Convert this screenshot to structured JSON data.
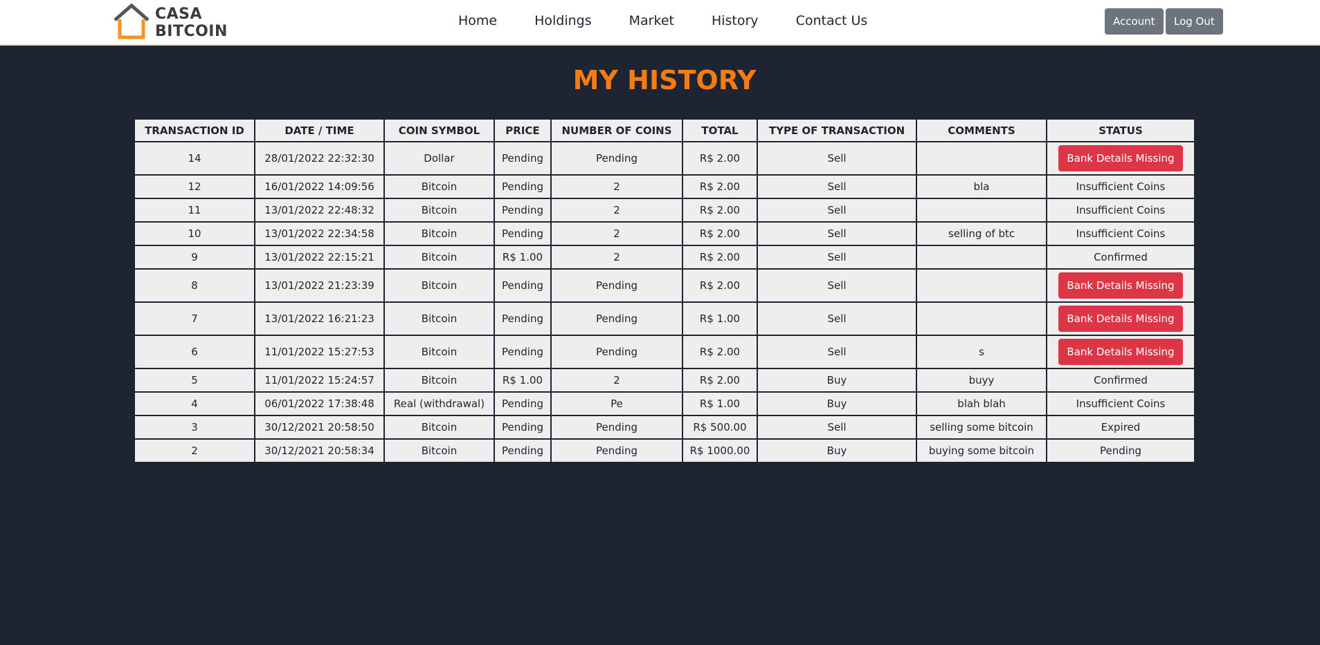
{
  "brand": {
    "line1": "CASA",
    "line2": "BITCOIN",
    "color": "#f7941d"
  },
  "nav": {
    "links": [
      "Home",
      "Holdings",
      "Market",
      "History",
      "Contact Us"
    ],
    "account_label": "Account",
    "logout_label": "Log Out"
  },
  "page": {
    "title": "MY HISTORY"
  },
  "table": {
    "headers": [
      "TRANSACTION ID",
      "DATE / TIME",
      "COIN SYMBOL",
      "PRICE",
      "NUMBER OF COINS",
      "TOTAL",
      "TYPE OF TRANSACTION",
      "COMMENTS",
      "STATUS"
    ],
    "rows": [
      [
        "14",
        "28/01/2022 22:32:30",
        "Dollar",
        "Pending",
        "Pending",
        "R$ 2.00",
        "Sell",
        "",
        "Bank Details Missing"
      ],
      [
        "12",
        "16/01/2022 14:09:56",
        "Bitcoin",
        "Pending",
        "2",
        "R$ 2.00",
        "Sell",
        "bla",
        "Insufficient Coins"
      ],
      [
        "11",
        "13/01/2022 22:48:32",
        "Bitcoin",
        "Pending",
        "2",
        "R$ 2.00",
        "Sell",
        "",
        "Insufficient Coins"
      ],
      [
        "10",
        "13/01/2022 22:34:58",
        "Bitcoin",
        "Pending",
        "2",
        "R$ 2.00",
        "Sell",
        "selling of btc",
        "Insufficient Coins"
      ],
      [
        "9",
        "13/01/2022 22:15:21",
        "Bitcoin",
        "R$ 1.00",
        "2",
        "R$ 2.00",
        "Sell",
        "",
        "Confirmed"
      ],
      [
        "8",
        "13/01/2022 21:23:39",
        "Bitcoin",
        "Pending",
        "Pending",
        "R$ 2.00",
        "Sell",
        "",
        "Bank Details Missing"
      ],
      [
        "7",
        "13/01/2022 16:21:23",
        "Bitcoin",
        "Pending",
        "Pending",
        "R$ 1.00",
        "Sell",
        "",
        "Bank Details Missing"
      ],
      [
        "6",
        "11/01/2022 15:27:53",
        "Bitcoin",
        "Pending",
        "Pending",
        "R$ 2.00",
        "Sell",
        "s",
        "Bank Details Missing"
      ],
      [
        "5",
        "11/01/2022 15:24:57",
        "Bitcoin",
        "R$ 1.00",
        "2",
        "R$ 2.00",
        "Buy",
        "buyy",
        "Confirmed"
      ],
      [
        "4",
        "06/01/2022 17:38:48",
        "Real (withdrawal)",
        "Pending",
        "Pe",
        "R$ 1.00",
        "Buy",
        "blah blah",
        "Insufficient Coins"
      ],
      [
        "3",
        "30/12/2021 20:58:50",
        "Bitcoin",
        "Pending",
        "Pending",
        "R$ 500.00",
        "Sell",
        "selling some bitcoin",
        "Expired"
      ],
      [
        "2",
        "30/12/2021 20:58:34",
        "Bitcoin",
        "Pending",
        "Pending",
        "R$ 1000.00",
        "Buy",
        "buying some bitcoin",
        "Pending"
      ]
    ],
    "action_status": "Bank Details Missing"
  },
  "colors": {
    "background": "#1f2433",
    "accent": "#f57c12",
    "danger": "#dc3545",
    "secondary": "#6c757d"
  }
}
